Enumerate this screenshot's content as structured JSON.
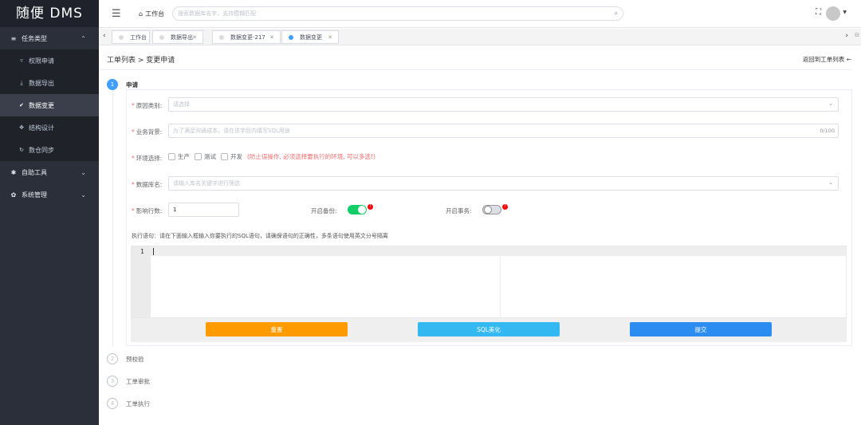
{
  "app": {
    "title": "随便 DMS"
  },
  "sidebar": {
    "groups": [
      {
        "label": "任务类型",
        "icon": "list-icon",
        "expanded": true,
        "items": [
          {
            "label": "权限申请",
            "icon": "filter-icon"
          },
          {
            "label": "数据导出",
            "icon": "download-icon"
          },
          {
            "label": "数据变更",
            "icon": "check-circle-icon",
            "active": true
          },
          {
            "label": "结构设计",
            "icon": "structure-icon"
          },
          {
            "label": "数仓同步",
            "icon": "sync-icon"
          }
        ]
      },
      {
        "label": "自助工具",
        "icon": "tools-icon",
        "expanded": false
      },
      {
        "label": "系统管理",
        "icon": "settings-icon",
        "expanded": false
      }
    ]
  },
  "topbar": {
    "home_label": "工作台",
    "search_placeholder": "搜索数据库名字，支持模糊匹配"
  },
  "tabs": [
    {
      "label": "工作台",
      "closable": false,
      "active": false
    },
    {
      "label": "数据导出",
      "closable": true,
      "active": false
    },
    {
      "label": "数据变更-217",
      "closable": true,
      "active": false
    },
    {
      "label": "数据变更",
      "closable": true,
      "active": true
    }
  ],
  "page": {
    "breadcrumb": "工单列表 > 变更申请",
    "back_link": "返回到工单列表"
  },
  "steps": [
    {
      "num": "1",
      "label": "申请",
      "current": true
    },
    {
      "num": "2",
      "label": "预校验",
      "current": false
    },
    {
      "num": "3",
      "label": "工单审批",
      "current": false
    },
    {
      "num": "4",
      "label": "工单执行",
      "current": false
    }
  ],
  "form": {
    "reason_label": "原因类别:",
    "reason_placeholder": "请选择",
    "background_label": "业务背景:",
    "background_placeholder": "为了满足沟通成本，请在该字段内填写SQL用途",
    "background_counter": "0/100",
    "env_label": "环境选择:",
    "env_options": [
      "生产",
      "测试",
      "开发"
    ],
    "env_warning": "(防止误操作, 必须选择要执行的环境, 可以多选!)",
    "db_label": "数据库名:",
    "db_placeholder": "请输入库名关键字进行筛选",
    "rows_label": "影响行数:",
    "rows_value": "1",
    "backup_label": "开启备份:",
    "backup_on": true,
    "transaction_label": "开启事务:",
    "transaction_on": false,
    "info_mark": "!",
    "sql_hint": "执行语句：请在下面输入框输入你要执行的SQL语句，请确保语句的正确性，多条语句使用英文分号隔离",
    "editor_line": "1"
  },
  "buttons": {
    "reset": "重置",
    "beautify": "SQL美化",
    "submit": "提交"
  },
  "colors": {
    "sidebar_bg": "#2b2f3a",
    "primary": "#409eff",
    "warning": "#ff9a00",
    "info": "#34b8f2",
    "submit": "#2d8cf0",
    "success": "#13ce66",
    "danger": "#f56c6c"
  }
}
